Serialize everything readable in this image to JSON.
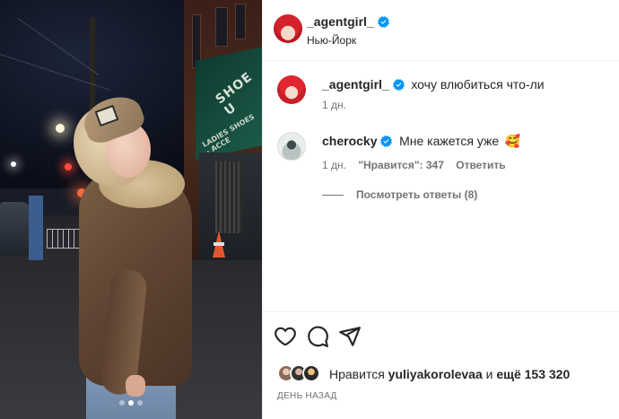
{
  "post": {
    "author": "_agentgirl_",
    "location": "Нью-Йорк",
    "media_alt": "Photo of a woman in a fur-lined jacket and cap on a city street at night",
    "carousel_dots": 3,
    "carousel_active": 1
  },
  "store_sign": {
    "line1": "SHOE U",
    "line2": "LADIES SHOES · ACCE"
  },
  "caption": {
    "author": "_agentgirl_",
    "text": "хочу влюбиться что-ли",
    "time": "1 дн."
  },
  "comment": {
    "author": "cherocky",
    "text": "Мне кажется уже",
    "emoji": "🥰",
    "time": "1 дн.",
    "likes_label": "\"Нравится\": 347",
    "reply_label": "Ответить",
    "view_replies": "Посмотреть ответы (8)"
  },
  "likes": {
    "prefix": "Нравится",
    "user": "yuliyakorolevaa",
    "middle": "и",
    "others": "ещё 153 320"
  },
  "date_label": "ДЕНЬ НАЗАД",
  "colors": {
    "verified": "#0095f6",
    "muted": "#737373",
    "text": "#262626"
  },
  "icons": [
    "heart-icon",
    "comment-icon",
    "share-icon",
    "verified-badge-icon"
  ]
}
